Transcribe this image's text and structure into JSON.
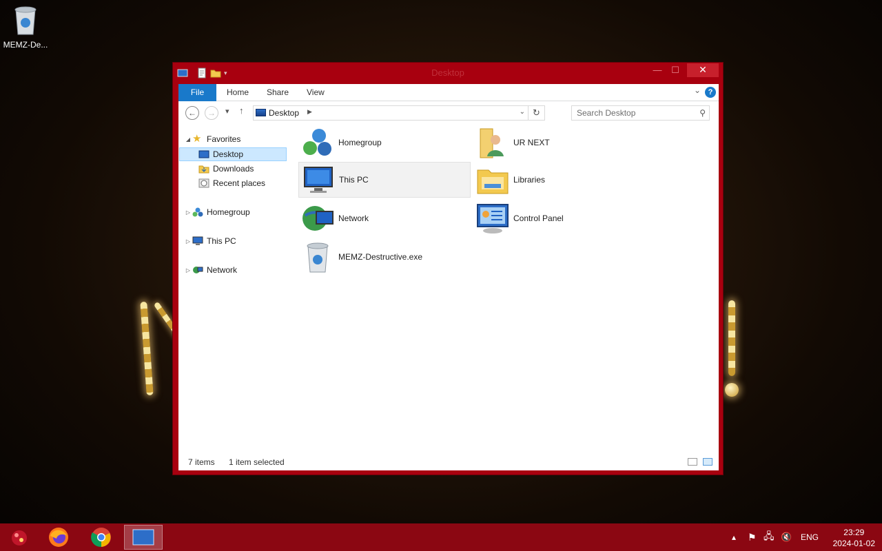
{
  "desktop": {
    "recycle_label": "MEMZ-De..."
  },
  "window": {
    "title": "Desktop",
    "minimize": "—",
    "maximize": "☐",
    "close": "✕"
  },
  "ribbon": {
    "tabs": [
      "File",
      "Home",
      "Share",
      "View"
    ],
    "help": "?"
  },
  "address": {
    "breadcrumb": "Desktop",
    "search_placeholder": "Search Desktop"
  },
  "nav_pane": {
    "favorites": "Favorites",
    "desktop": "Desktop",
    "downloads": "Downloads",
    "recent": "Recent places",
    "homegroup": "Homegroup",
    "this_pc": "This PC",
    "network": "Network"
  },
  "items": [
    {
      "label": "Homegroup",
      "icon": "homegroup-icon"
    },
    {
      "label": "UR NEXT",
      "icon": "user-folder-icon"
    },
    {
      "label": "This PC",
      "icon": "computer-icon"
    },
    {
      "label": "Libraries",
      "icon": "libraries-icon"
    },
    {
      "label": "Network",
      "icon": "network-icon"
    },
    {
      "label": "Control Panel",
      "icon": "control-panel-icon"
    },
    {
      "label": "MEMZ-Destructive.exe",
      "icon": "recycle-bin-icon"
    }
  ],
  "status": {
    "count": "7 items",
    "selected": "1 item selected"
  },
  "taskbar": {
    "lang": "ENG",
    "time": "23:29",
    "date": "2024-01-02"
  },
  "colors": {
    "accent": "#1979ca",
    "frame": "#a8000f",
    "taskbar": "#8b0712"
  }
}
